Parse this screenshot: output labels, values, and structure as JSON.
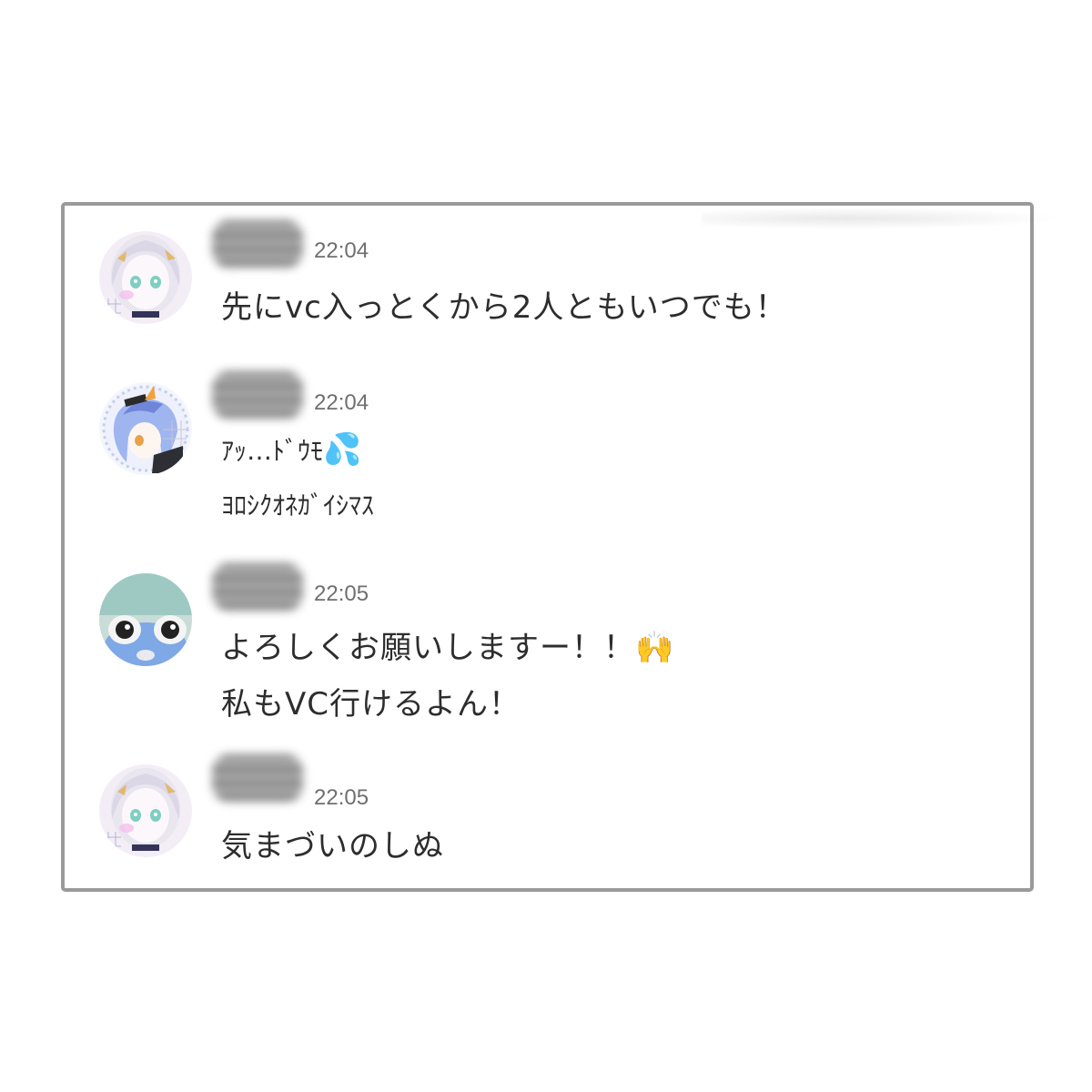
{
  "messages": [
    {
      "time": "22:04",
      "lines": [
        "先にvc入っとくから2人ともいつでも！"
      ]
    },
    {
      "time": "22:04",
      "lines": [
        "ｱｯ…ﾄﾞｳﾓ",
        "ﾖﾛｼｸｵﾈｶﾞｲｼﾏｽ"
      ],
      "emoji": "💦"
    },
    {
      "time": "22:05",
      "lines": [
        "よろしくお願いしますー！！",
        "私もVC行けるよん！"
      ],
      "emoji": "🙌"
    },
    {
      "time": "22:05",
      "lines": [
        "気まづいのしぬ"
      ]
    }
  ]
}
